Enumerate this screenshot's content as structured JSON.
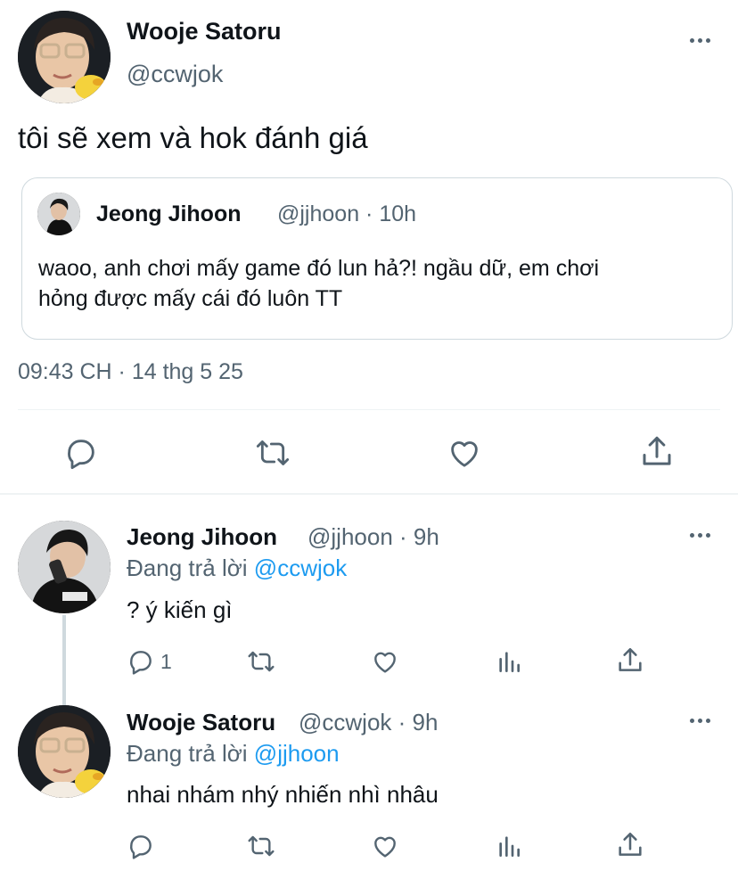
{
  "main_tweet": {
    "author_name": "Wooje Satoru",
    "author_handle": "@ccwjok",
    "text": "tôi sẽ xem và hok đánh giá",
    "quote": {
      "author_name": "Jeong Jihoon",
      "meta": "@jjhoon · 10h",
      "text_line1": "waoo, anh chơi mấy game đó lun hả?! ngầu dữ, em chơi",
      "text_line2": "hỏng được mấy cái đó luôn TT"
    },
    "timestamp": "09:43 CH · 14 thg 5 25"
  },
  "replies": [
    {
      "author_name": "Jeong Jihoon",
      "meta": "@jjhoon · 9h",
      "replying_prefix": "Đang trả lời",
      "replying_to": "@ccwjok",
      "text": "? ý kiến gì",
      "reply_count": "1"
    },
    {
      "author_name": "Wooje Satoru",
      "meta": "@ccwjok · 9h",
      "replying_prefix": "Đang trả lời",
      "replying_to": "@jjhoon",
      "text": "nhai nhám nhý nhiến nhì nhâu",
      "reply_count": ""
    }
  ],
  "colors": {
    "text": "#0f1419",
    "muted": "#536471",
    "link": "#1d9bf0",
    "divider": "#eff3f4"
  },
  "icons": [
    "more-icon",
    "reply-icon",
    "retweet-icon",
    "like-icon",
    "share-icon",
    "views-icon"
  ]
}
